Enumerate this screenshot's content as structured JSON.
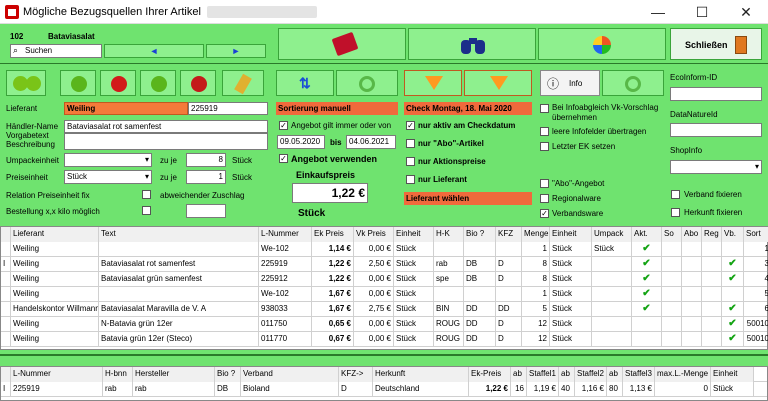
{
  "window": {
    "title": "Mögliche Bezugsquellen Ihrer Artikel",
    "min": "—",
    "max": "☐",
    "close": "✕"
  },
  "article": {
    "number": "102",
    "name": "Bataviasalat",
    "search_label": "Suchen"
  },
  "nav": {
    "prev": "◄",
    "next": "►"
  },
  "close_button": "Schließen",
  "form": {
    "lieferant_label": "Lieferant",
    "lieferant_value": "Weiling",
    "lieferant_number": "225919",
    "haendler_label": "Händler-Name",
    "haendler_value": "Bataviasalat rot samenfest",
    "vorgabe_label": "Vorgabetext",
    "beschreibung_label": "Beschreibung",
    "umpack_label": "Umpackeinheit",
    "zu_je_1": "zu je",
    "umpack_qty": "8",
    "umpack_unit": "Stück",
    "preis_label": "Preiseinheit",
    "preis_value": "Stück",
    "zu_je_2": "zu je",
    "preis_qty": "1",
    "preis_unit": "Stück",
    "relation_label": "Relation Preiseinheit fix",
    "abweichend_label": "abweichender Zuschlag",
    "bestellung_label": "Bestellung x,x kilo möglich"
  },
  "sortierung": {
    "header": "Sortierung manuell",
    "angebot_label": "Angebot gilt immer  oder von",
    "from": "09.05.2020",
    "bis": "bis",
    "to": "04.06.2021",
    "verwenden_label": "Angebot verwenden",
    "einkauf_label": "Einkaufspreis",
    "price": "1,22 €",
    "unit": "Stück"
  },
  "check": {
    "header": "Check Montag, 18. Mai 2020",
    "opt1": "nur aktiv am Checkdatum",
    "opt2": "nur \"Abo\"-Artikel",
    "opt3": "nur Aktionspreise",
    "opt4": "nur  Lieferant",
    "footer": "Lieferant wählen"
  },
  "info": {
    "button": "Info",
    "opt1": "Bei Infoabgleich  Vk-Vorschlag übernehmen",
    "opt2": "leere Infofelder übertragen",
    "opt3": "Letzter EK setzen",
    "abo": "\"Abo\"-Angebot",
    "regional": "Regionalware",
    "verband": "Verbandsware"
  },
  "ids": {
    "ecoinform": "EcoInform-ID",
    "datanature": "DataNatureId",
    "shopinfo": "ShopInfo",
    "verband_fix": "Verband fixieren",
    "herkunft_fix": "Herkunft fixieren"
  },
  "main_table": {
    "headers": [
      "Lieferant",
      "Text",
      "L-Nummer",
      "Ek Preis",
      "Vk Preis",
      "Einheit",
      "H-K",
      "Bio ?",
      "KFZ",
      "Menge",
      "Einheit",
      "Umpack",
      "Akt.",
      "So",
      "Abo",
      "Reg",
      "Vb.",
      "Sort"
    ],
    "rows": [
      [
        "Weiling",
        "",
        "We-102",
        "1,14 €",
        "0,00 €",
        "Stück",
        "",
        "",
        "",
        "1",
        "Stück",
        "Stück",
        "✔",
        "",
        "",
        "",
        "",
        "1"
      ],
      [
        "Weiling",
        "Bataviasalat rot samenfest",
        "225919",
        "1,22 €",
        "2,50 €",
        "Stück",
        "rab",
        "DB",
        "D",
        "8",
        "Stück",
        "",
        "✔",
        "",
        "",
        "",
        "✔",
        "3"
      ],
      [
        "Weiling",
        "Bataviasalat grün samenfest",
        "225912",
        "1,22 €",
        "0,00 €",
        "Stück",
        "spe",
        "DB",
        "D",
        "8",
        "Stück",
        "",
        "✔",
        "",
        "",
        "",
        "✔",
        "4"
      ],
      [
        "Weiling",
        "",
        "We-102",
        "1,67 €",
        "0,00 €",
        "Stück",
        "",
        "",
        "",
        "1",
        "Stück",
        "",
        "✔",
        "",
        "",
        "",
        "",
        "5"
      ],
      [
        "Handelskontor Willmann",
        "Bataviasalat Maravilla de V. A",
        "938033",
        "1,67 €",
        "2,75 €",
        "Stück",
        "BIN",
        "DD",
        "DD",
        "5",
        "Stück",
        "",
        "✔",
        "",
        "",
        "",
        "✔",
        "6"
      ],
      [
        "Weiling",
        "N-Batavia grün 12er",
        "011750",
        "0,65 €",
        "0,00 €",
        "Stück",
        "ROUG",
        "DD",
        "D",
        "12",
        "Stück",
        "",
        "",
        "",
        "",
        "",
        "✔",
        "50010"
      ],
      [
        "Weiling",
        "Batavia grün 12er (Steco)",
        "011770",
        "0,67 €",
        "0,00 €",
        "Stück",
        "ROUG",
        "DD",
        "D",
        "12",
        "Stück",
        "",
        "",
        "",
        "",
        "",
        "✔",
        "50010"
      ]
    ]
  },
  "bottom_table": {
    "headers": [
      "L-Nummer",
      "H-bnn",
      "Hersteller",
      "Bio ?",
      "Verband",
      "KFZ->",
      "Herkunft",
      "Ek-Preis",
      "ab",
      "Staffel1",
      "ab",
      "Staffel2",
      "ab",
      "Staffel3",
      "max.L.-Menge",
      "Einheit"
    ],
    "rows": [
      [
        "225919",
        "rab",
        "rab",
        "DB",
        "Bioland",
        "D",
        "Deutschland",
        "1,22 €",
        "16",
        "1,19 €",
        "40",
        "1,16 €",
        "80",
        "1,13 €",
        "0",
        "Stück"
      ]
    ]
  },
  "colors": {
    "panel": "#6fe36f",
    "orange": "#f47a3a",
    "accent": "#2a7a2a"
  }
}
